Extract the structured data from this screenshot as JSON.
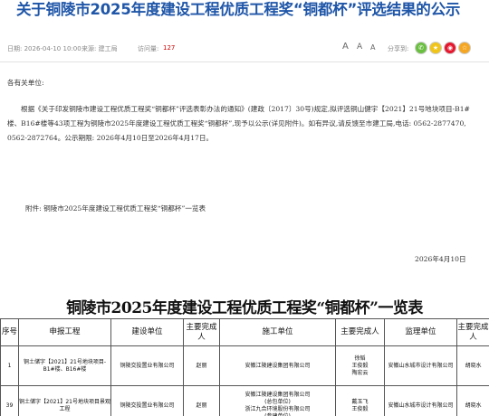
{
  "header": {
    "title": "关于铜陵市2025年度建设工程优质工程奖“铜都杯”评选结果的公示"
  },
  "meta": {
    "date_label": "日期: 2026-04-10 10:00",
    "source_label": "来源: 建工局",
    "visits_label": "访问量:",
    "visits_value": "127",
    "font_large": "A",
    "font_medium": "A",
    "font_small": "A",
    "share_label": "分享到:",
    "share_icons": [
      {
        "name": "wechat-icon",
        "color": "#6abf40",
        "glyph": "✆"
      },
      {
        "name": "qzone-icon",
        "color": "#f0c419",
        "glyph": "★"
      },
      {
        "name": "weibo-icon",
        "color": "#e6162d",
        "glyph": "◉"
      },
      {
        "name": "favorite-icon",
        "color": "#f5a623",
        "glyph": "☆"
      }
    ]
  },
  "content": {
    "greeting": "各有关单位:",
    "paragraph": "根据《关于印发铜陵市建设工程优质工程奖“铜都杯”评选表彰办法的通知》(建政〔2017〕30号)规定,拟评选铜山健宇【2021】21号地块项目-B1#楼、B16#楼等43项工程为铜陵市2025年度建设工程优质工程奖“铜都杯”,现予以公示(详见附件)。如有异议,请反馈至市建工局,电话: 0562-2877470, 0562-2872764。公示期限: 2026年4月10日至2026年4月17日。",
    "attachment": "附件: 铜陵市2025年度建设工程优质工程奖“铜都杯”一览表",
    "date": "2026年4月10日"
  },
  "table": {
    "title": "铜陵市2025年度建设工程优质工程奖“铜都杯”一览表",
    "headers": [
      "序号",
      "申报工程",
      "建设单位",
      "主要完成人",
      "施工单位",
      "主要完成人",
      "监理单位",
      "主要完成人"
    ],
    "rows": [
      {
        "no": "1",
        "project": "铜土储字【2021】21号地块项目-B1#楼、B16#楼",
        "builder": "铜陵交投置业有限公司",
        "builder_person": "赵丽",
        "contractor": "安徽江陵建设集团有限公司",
        "contractor_persons": "徐韬\n王俊毅\n陶宏云",
        "supervisor": "安徽山水城市设计有限公司",
        "supervisor_person": "胡晓水"
      },
      {
        "no": "39",
        "project": "铜土储字【2021】21号地块项目景观工程",
        "builder": "铜陵交投置业有限公司",
        "builder_person": "赵丽",
        "contractor": "安徽江陵建设集团有限公司\n(总包单位)\n浙江九合环境股份有限公司\n(参建单位)",
        "contractor_persons": "戴玉飞\n王俊毅",
        "supervisor": "安徽山水城市设计有限公司",
        "supervisor_person": "胡晓水"
      }
    ]
  }
}
